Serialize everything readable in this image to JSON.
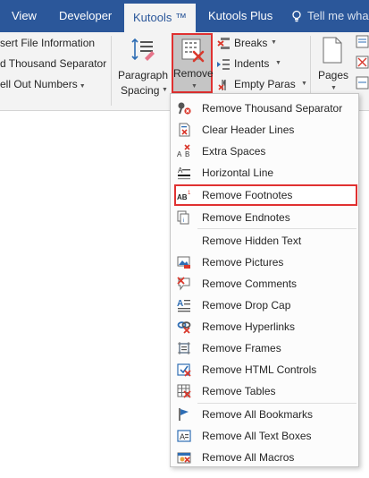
{
  "tabs": {
    "view": "View",
    "developer": "Developer",
    "kutools": "Kutools ™",
    "kutools_plus": "Kutools Plus",
    "tell_me": "Tell me wha"
  },
  "ribbon": {
    "insert_file_info": "sert File Information",
    "thousand_separator": "d Thousand Separator",
    "spell_out_numbers": "ell Out Numbers",
    "paragraph_spacing_line1": "Paragraph",
    "paragraph_spacing_line2": "Spacing",
    "remove_label": "Remove",
    "breaks": "Breaks",
    "indents": "Indents",
    "empty_paras": "Empty Paras",
    "pages": "Pages"
  },
  "menu": {
    "items": [
      {
        "label": "Remove Thousand Separator",
        "icon": "thousand-separator-icon"
      },
      {
        "label": "Clear Header Lines",
        "icon": "clear-header-lines-icon"
      },
      {
        "label": "Extra Spaces",
        "icon": "extra-spaces-icon"
      },
      {
        "label": "Horizontal Line",
        "icon": "horizontal-line-icon"
      },
      {
        "label": "Remove Footnotes",
        "icon": "footnotes-icon",
        "highlighted": true
      },
      {
        "label": "Remove Endnotes",
        "icon": "endnotes-icon"
      },
      {
        "label": "Remove Hidden Text",
        "icon": ""
      },
      {
        "label": "Remove Pictures",
        "icon": "pictures-icon"
      },
      {
        "label": "Remove Comments",
        "icon": "comments-icon"
      },
      {
        "label": "Remove Drop Cap",
        "icon": "drop-cap-icon"
      },
      {
        "label": "Remove Hyperlinks",
        "icon": "hyperlinks-icon"
      },
      {
        "label": "Remove Frames",
        "icon": "frames-icon"
      },
      {
        "label": "Remove HTML Controls",
        "icon": "html-controls-icon"
      },
      {
        "label": "Remove Tables",
        "icon": "tables-icon"
      },
      {
        "label": "Remove All Bookmarks",
        "icon": "bookmarks-icon"
      },
      {
        "label": "Remove All Text Boxes",
        "icon": "text-boxes-icon"
      },
      {
        "label": "Remove All Macros",
        "icon": "macros-icon"
      }
    ]
  },
  "colors": {
    "tab_bar": "#2b579a",
    "ribbon": "#f3f3f3",
    "highlight_border": "#e03131",
    "icon_red": "#d9382c",
    "icon_blue": "#2e6db4"
  }
}
